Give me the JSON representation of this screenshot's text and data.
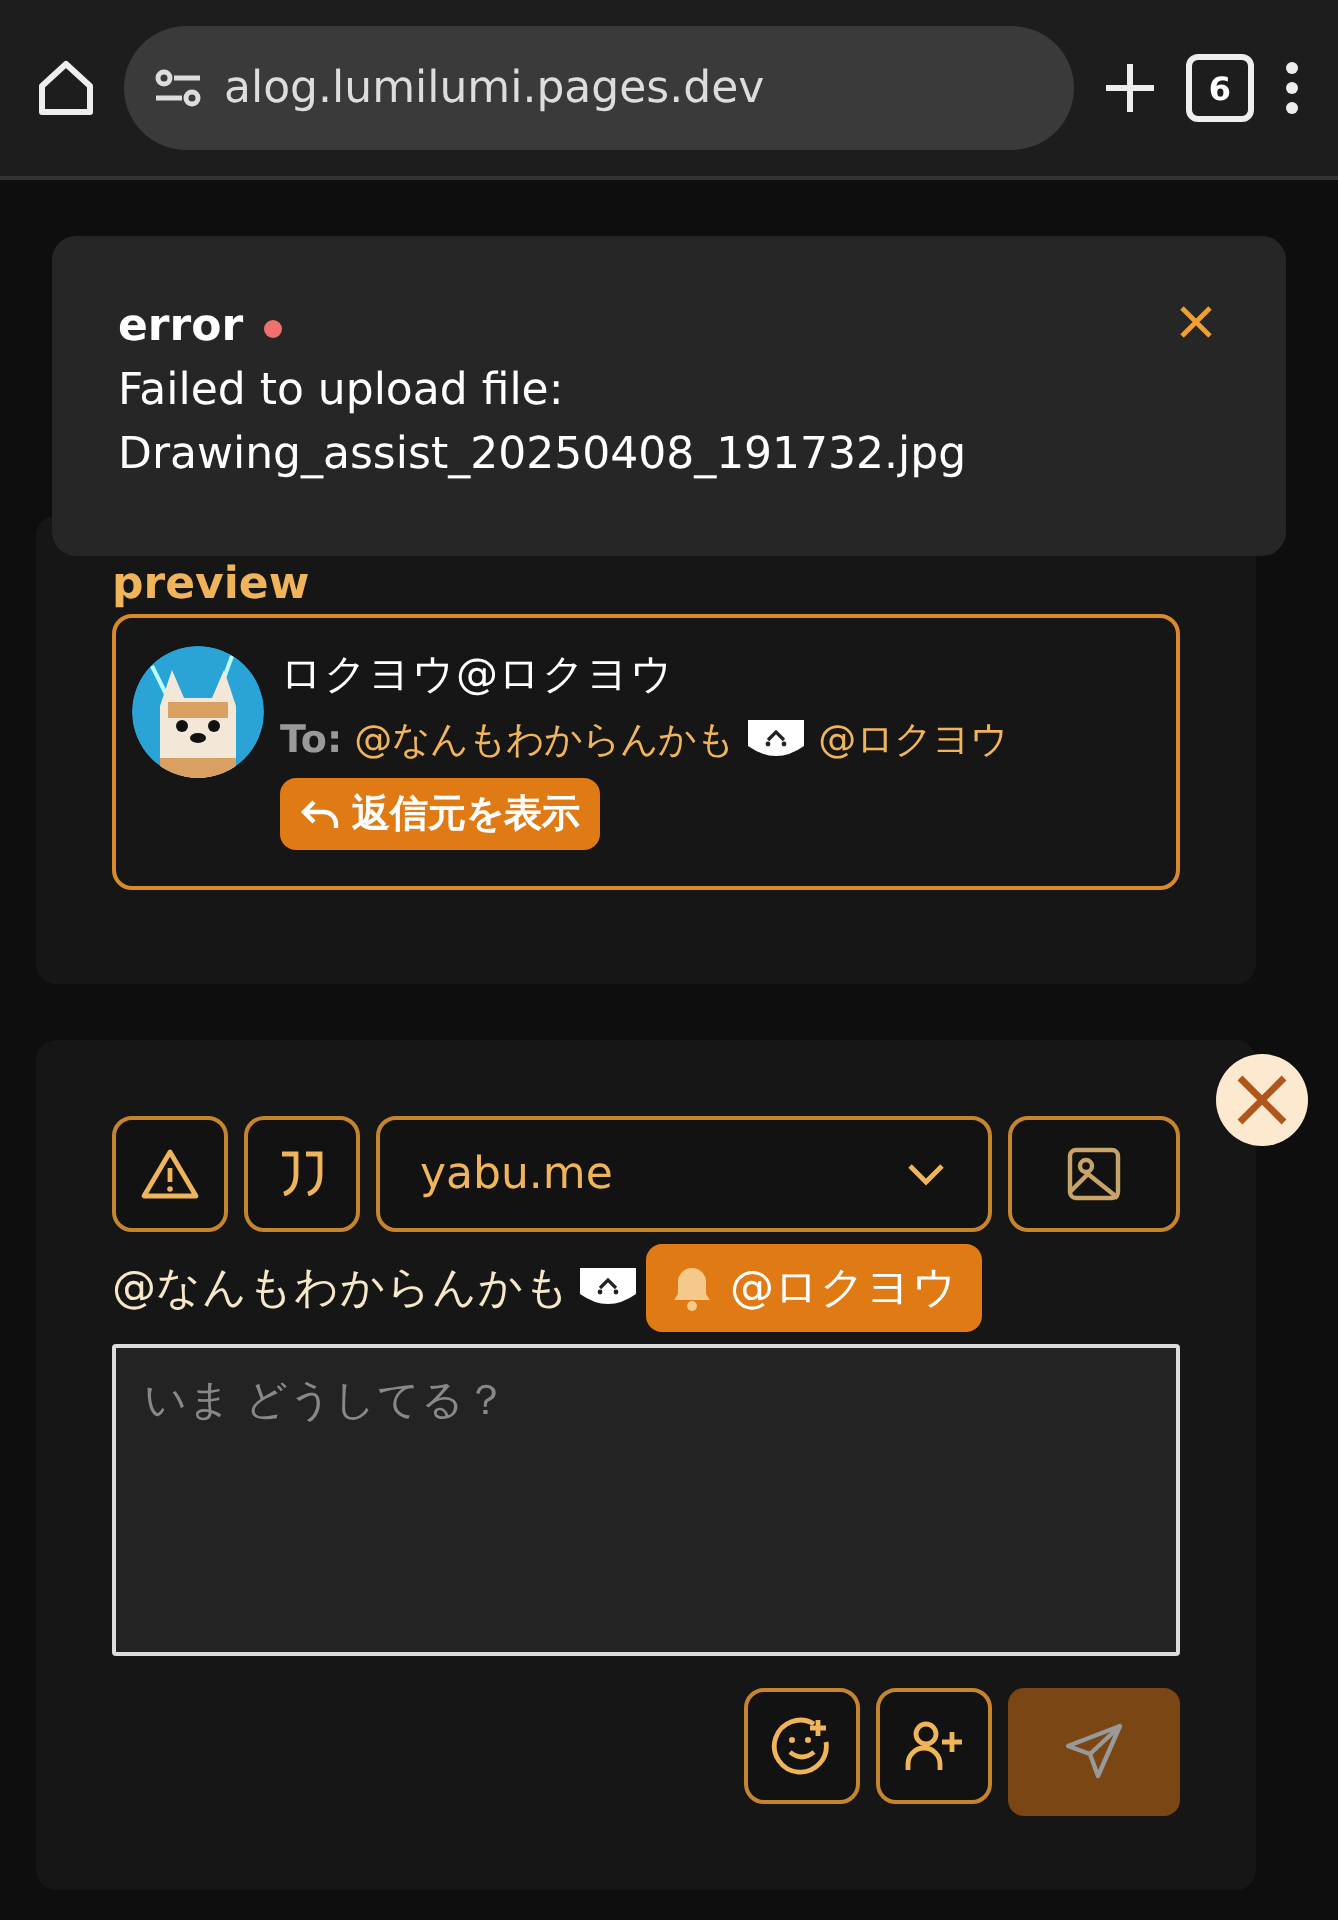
{
  "browser": {
    "url": "alog.lumilumi.pages.dev",
    "tab_count": "6"
  },
  "toast": {
    "title": "error",
    "lines": [
      "Failed to upload file:",
      "Drawing_assist_20250408_191732.jpg"
    ]
  },
  "preview": {
    "label": "preview",
    "name": "ロクヨウ@ロクヨウ",
    "to_label": "To:",
    "recipients": [
      {
        "text": "@なんもわからんかも",
        "emoji": true
      },
      {
        "text": "@ロクヨウ",
        "emoji": false
      }
    ],
    "reply_button": "返信元を表示"
  },
  "compose": {
    "server": "yabu.me",
    "mention": {
      "text": "@なんもわからんかも",
      "emoji": true
    },
    "notify_chip": "@ロクヨウ",
    "placeholder": "いま どうしてる？",
    "send_disabled": true
  }
}
